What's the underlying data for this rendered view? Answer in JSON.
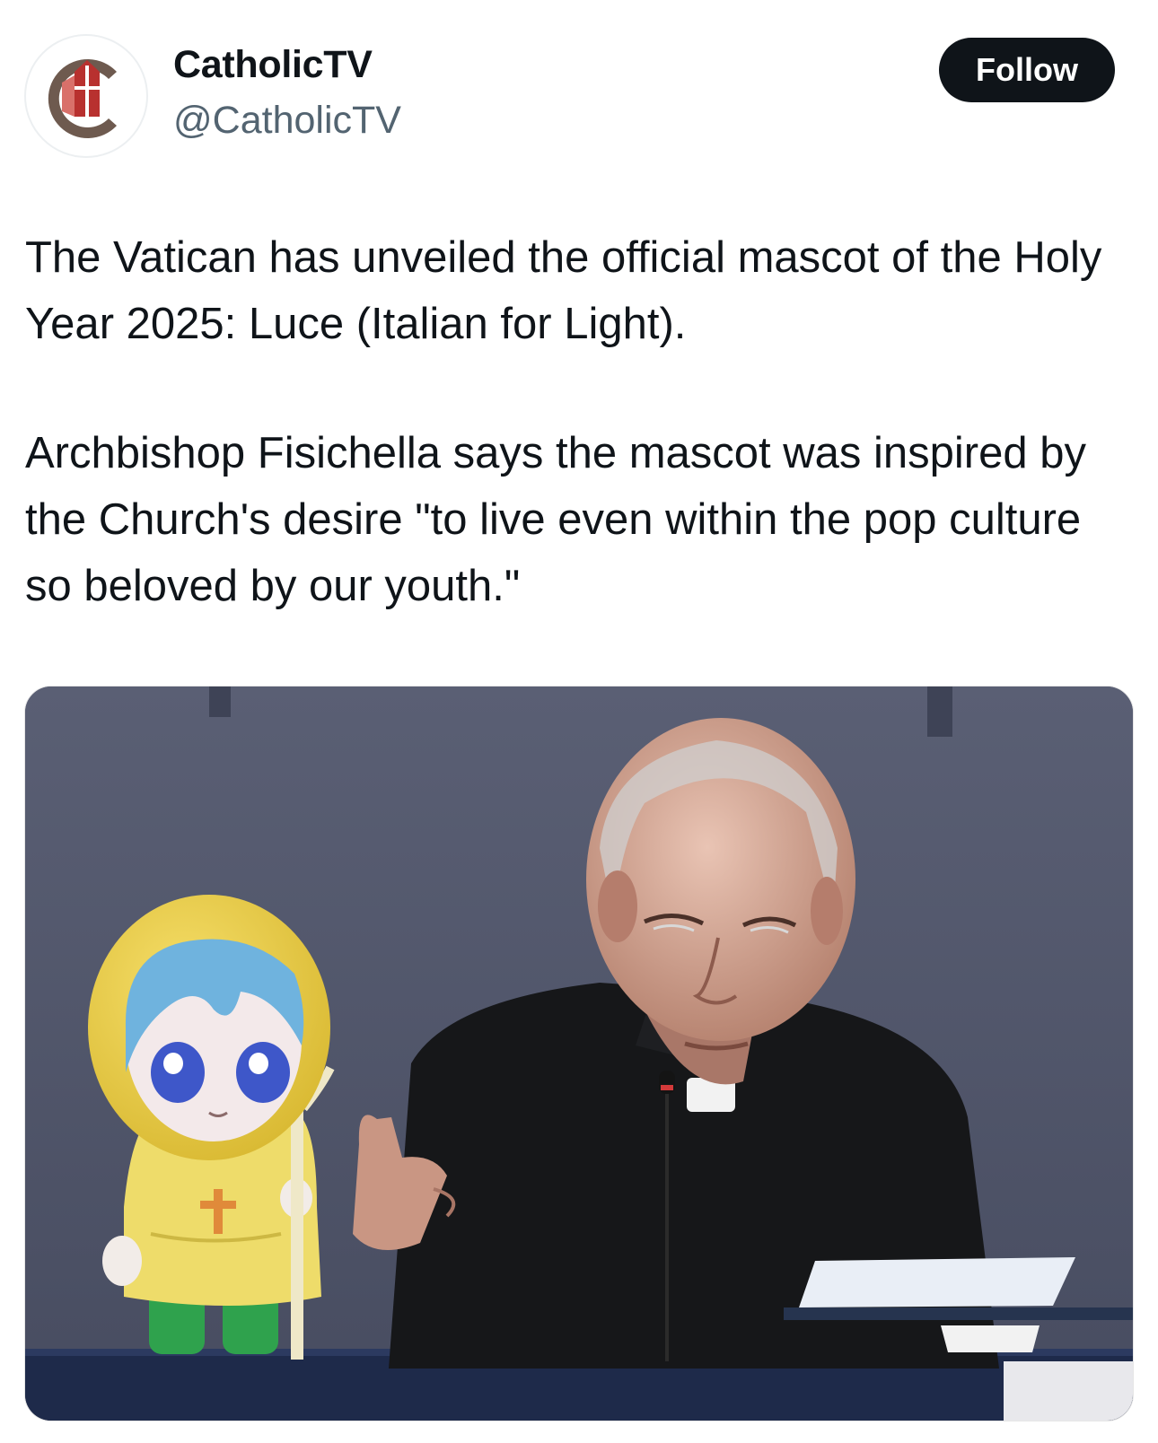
{
  "account": {
    "display_name": "CatholicTV",
    "handle": "@CatholicTV",
    "avatar_icon": "catholictv-logo-icon"
  },
  "actions": {
    "follow_label": "Follow"
  },
  "post": {
    "paragraphs": [
      "The Vatican has unveiled the official mascot of the Holy Year 2025: Luce (Italian for Light).",
      "Archbishop Fisichella says the mascot was inspired by the Church's desire \"to live even within the pop culture so beloved by our youth.\""
    ]
  },
  "colors": {
    "follow_bg": "#0f1419",
    "handle_gray": "#536471",
    "logo_red": "#b8312f",
    "logo_brown": "#6e5a4f"
  }
}
